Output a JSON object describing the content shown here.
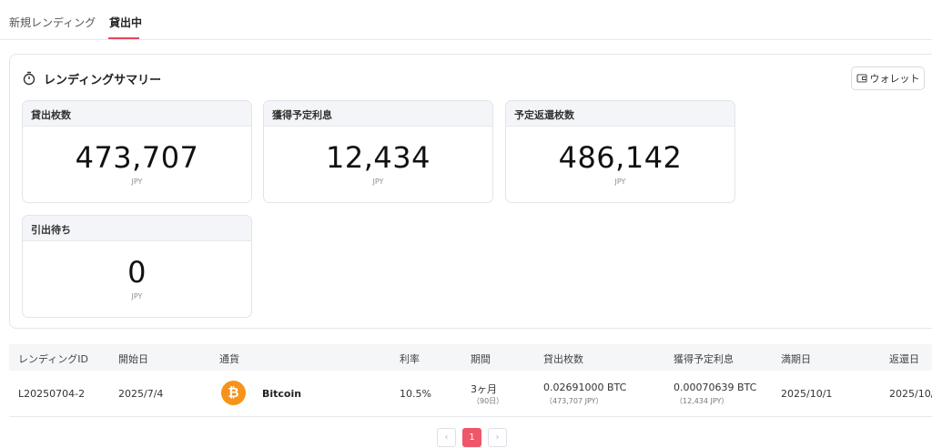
{
  "tabs": {
    "new": "新規レンディング",
    "active": "貸出中"
  },
  "summary": {
    "title": "レンディングサマリー",
    "wallet_label": "ウォレット",
    "cards": [
      {
        "label": "貸出枚数",
        "value": "473,707",
        "unit": "JPY"
      },
      {
        "label": "獲得予定利息",
        "value": "12,434",
        "unit": "JPY"
      },
      {
        "label": "予定返還枚数",
        "value": "486,142",
        "unit": "JPY"
      },
      {
        "label": "引出待ち",
        "value": "0",
        "unit": "JPY"
      }
    ]
  },
  "table": {
    "headers": [
      "レンディングID",
      "開始日",
      "通貨",
      "利率",
      "期間",
      "貸出枚数",
      "獲得予定利息",
      "満期日",
      "返還日"
    ],
    "rows": [
      {
        "id": "L20250704-2",
        "start": "2025/7/4",
        "currency": "Bitcoin",
        "rate": "10.5%",
        "period": "3ヶ月",
        "period_days": "（90日）",
        "amount": "0.02691000 BTC",
        "amount_jpy": "（473,707 JPY）",
        "interest": "0.00070639 BTC",
        "interest_jpy": "（12,434 JPY）",
        "maturity": "2025/10/1",
        "return": "2025/10/"
      }
    ]
  },
  "pagination": {
    "prev": "‹",
    "current": "1",
    "next": "›"
  },
  "colors": {
    "accent": "#f0566a",
    "bitcoin": "#f7931a",
    "card_header": "#f3f5f8"
  },
  "icons": {
    "timer": "timer-icon",
    "wallet": "wallet-icon",
    "bitcoin": "bitcoin-icon"
  }
}
